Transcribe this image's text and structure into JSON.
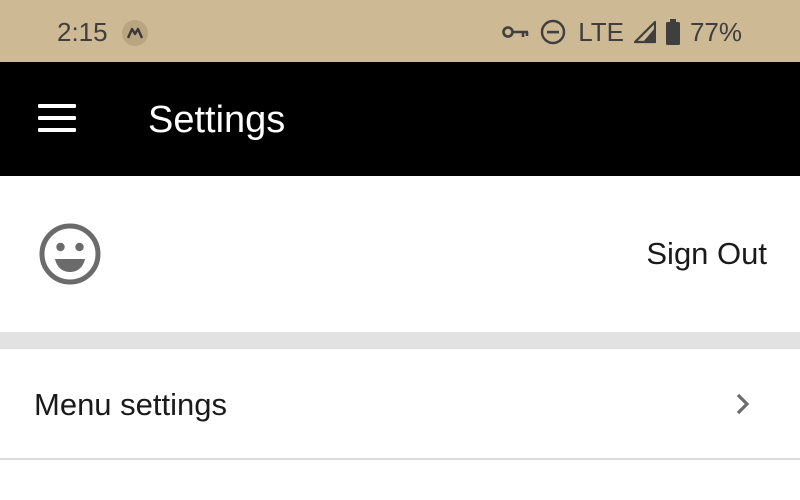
{
  "status_bar": {
    "time": "2:15",
    "network": "LTE",
    "battery": "77%",
    "icons": [
      "app-notification-icon",
      "vpn-key-icon",
      "do-not-disturb-icon",
      "signal-icon",
      "battery-icon"
    ]
  },
  "app_bar": {
    "title": "Settings",
    "menu_icon": "hamburger-menu-icon"
  },
  "account": {
    "avatar_icon": "smiley-face-icon",
    "sign_out_label": "Sign Out"
  },
  "settings_list": {
    "items": [
      {
        "label": "Menu settings",
        "icon": "chevron-right-icon"
      }
    ]
  },
  "colors": {
    "status_bar_bg": "#cdb994",
    "app_bar_bg": "#000000",
    "section_gap": "#e2e2e2"
  }
}
